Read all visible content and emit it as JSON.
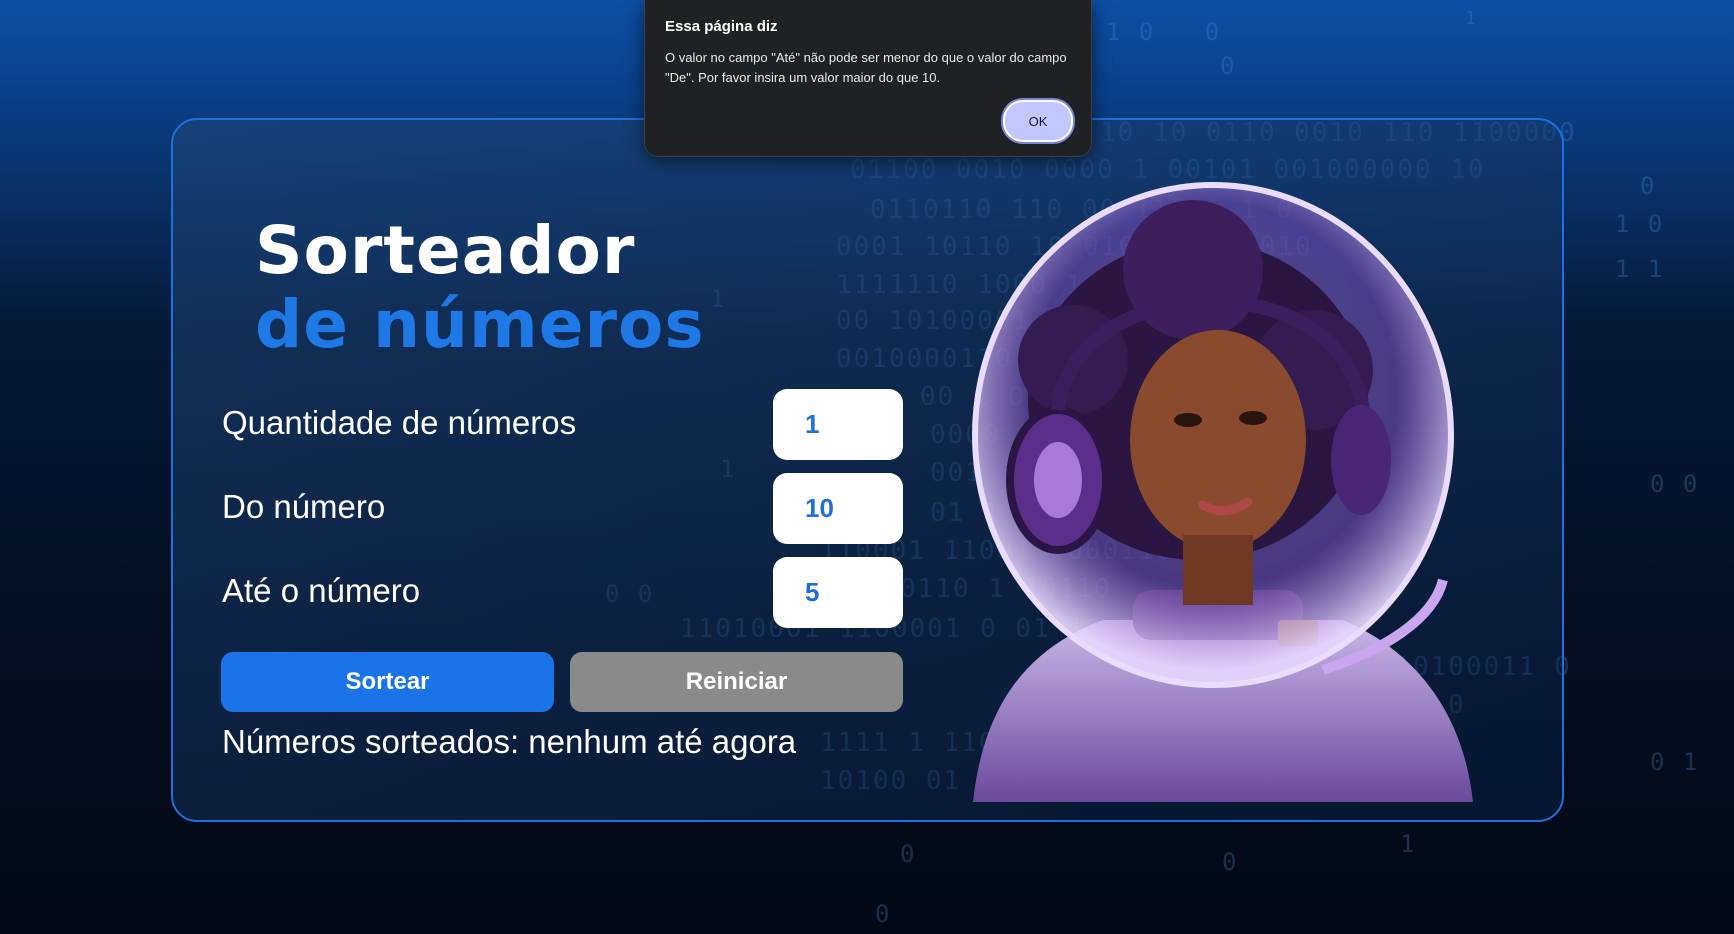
{
  "app": {
    "title_line1": "Sorteador",
    "title_line2": "de números"
  },
  "form": {
    "quantity": {
      "label": "Quantidade de números",
      "value": "1"
    },
    "from": {
      "label": "Do número",
      "value": "10"
    },
    "to": {
      "label": "Até o número",
      "value": "5"
    }
  },
  "buttons": {
    "draw_label": "Sortear",
    "reset_label": "Reiniciar"
  },
  "result_text": "Números sorteados: nenhum até agora",
  "dialog": {
    "title": "Essa página diz",
    "message": "O valor no campo \"Até\" não pode ser menor do que o valor do campo \"De\". Por favor insira um valor maior do que 10.",
    "ok_label": "OK"
  },
  "colors": {
    "accent": "#1e79e6",
    "primary_button": "#1a73e8",
    "secondary_button": "#8a8a8a",
    "dialog_bg": "#202124",
    "ok_button": "#c2c7ff"
  },
  "icons": {
    "illustration": "astronaut-girl-illustration"
  }
}
